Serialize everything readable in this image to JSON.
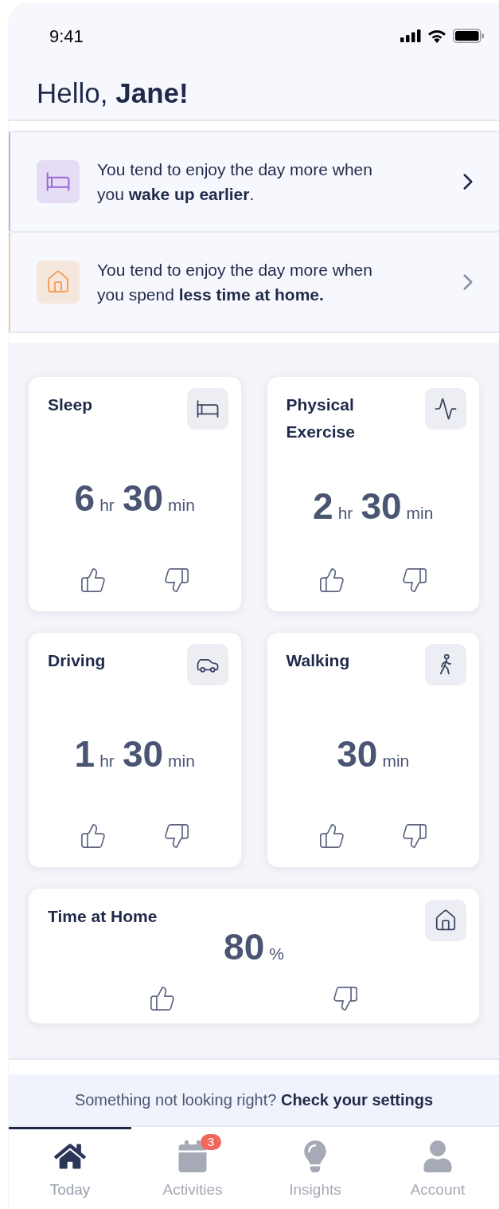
{
  "status_bar": {
    "time": "9:41"
  },
  "greeting": "Hello, **Jane!**",
  "insights": [
    {
      "text": "You tend to enjoy the day more when you **wake up earlier**.",
      "color": "#9a6ad6"
    },
    {
      "text": "You tend to enjoy the day more when you spend **less time at home.**",
      "color": "#f5a05a"
    }
  ],
  "tiles": [
    {
      "kind": "half",
      "title": "Sleep",
      "parts": [
        {
          "value": "6",
          "unit": "hr"
        },
        {
          "value": "30",
          "unit": "min"
        }
      ]
    },
    {
      "kind": "half",
      "title": "Physical Exercise",
      "parts": [
        {
          "value": "2",
          "unit": "hr"
        },
        {
          "value": "30",
          "unit": "min"
        }
      ]
    },
    {
      "kind": "half",
      "title": "Driving",
      "parts": [
        {
          "value": "1",
          "unit": "hr"
        },
        {
          "value": "30",
          "unit": "min"
        }
      ]
    },
    {
      "kind": "half",
      "title": "Walking",
      "parts": [
        {
          "value": "30",
          "unit": "min"
        }
      ]
    },
    {
      "kind": "wide",
      "title": "Time at Home",
      "parts": [
        {
          "value": "80",
          "unit": "%"
        }
      ]
    }
  ],
  "banner": "Something not looking right? **Check your settings**",
  "tabs": [
    {
      "label": "Today",
      "selected": true
    },
    {
      "label": "Activities",
      "selected": false,
      "badge": "3"
    },
    {
      "label": "Insights",
      "selected": false
    },
    {
      "label": "Account",
      "selected": false
    }
  ]
}
